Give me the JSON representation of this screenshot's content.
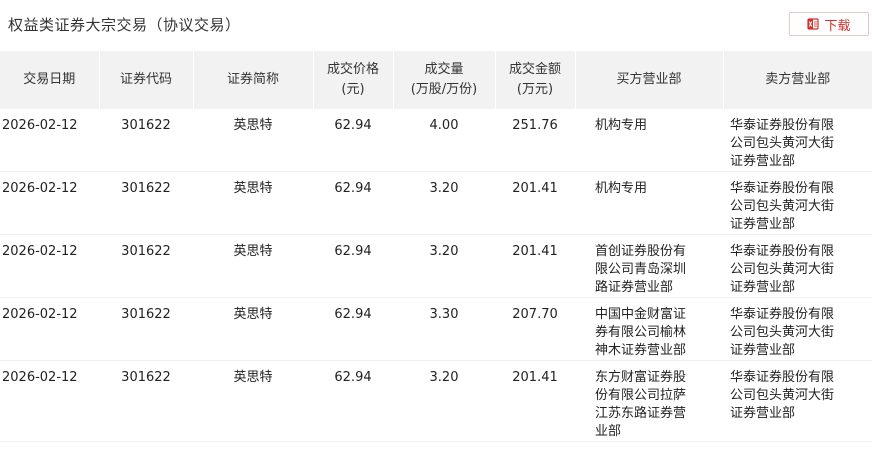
{
  "header": {
    "title": "权益类证券大宗交易（协议交易）",
    "download_label": "下载"
  },
  "table": {
    "columns": [
      {
        "line1": "交易日期",
        "line2": ""
      },
      {
        "line1": "证券代码",
        "line2": ""
      },
      {
        "line1": "证券简称",
        "line2": ""
      },
      {
        "line1": "成交价格",
        "line2": "(元)"
      },
      {
        "line1": "成交量",
        "line2": "(万股/万份)"
      },
      {
        "line1": "成交金额",
        "line2": "(万元)"
      },
      {
        "line1": "买方营业部",
        "line2": ""
      },
      {
        "line1": "卖方营业部",
        "line2": ""
      }
    ],
    "rows": [
      {
        "date": "2026-02-12",
        "code": "301622",
        "name": "英思特",
        "price": "62.94",
        "volume": "4.00",
        "amount": "251.76",
        "buyer": "机构专用",
        "seller": "华泰证券股份有限公司包头黄河大街证券营业部"
      },
      {
        "date": "2026-02-12",
        "code": "301622",
        "name": "英思特",
        "price": "62.94",
        "volume": "3.20",
        "amount": "201.41",
        "buyer": "机构专用",
        "seller": "华泰证券股份有限公司包头黄河大街证券营业部"
      },
      {
        "date": "2026-02-12",
        "code": "301622",
        "name": "英思特",
        "price": "62.94",
        "volume": "3.20",
        "amount": "201.41",
        "buyer": "首创证券股份有限公司青岛深圳路证券营业部",
        "seller": "华泰证券股份有限公司包头黄河大街证券营业部"
      },
      {
        "date": "2026-02-12",
        "code": "301622",
        "name": "英思特",
        "price": "62.94",
        "volume": "3.30",
        "amount": "207.70",
        "buyer": "中国中金财富证券有限公司榆林神木证券营业部",
        "seller": "华泰证券股份有限公司包头黄河大街证券营业部"
      },
      {
        "date": "2026-02-12",
        "code": "301622",
        "name": "英思特",
        "price": "62.94",
        "volume": "3.20",
        "amount": "201.41",
        "buyer": "东方财富证券股份有限公司拉萨江苏东路证券营业部",
        "seller": "华泰证券股份有限公司包头黄河大街证券营业部"
      }
    ]
  },
  "icons": {
    "download": "excel-download-icon"
  },
  "colors": {
    "accent": "#d0302c",
    "header_bg": "#f2f2f2"
  }
}
